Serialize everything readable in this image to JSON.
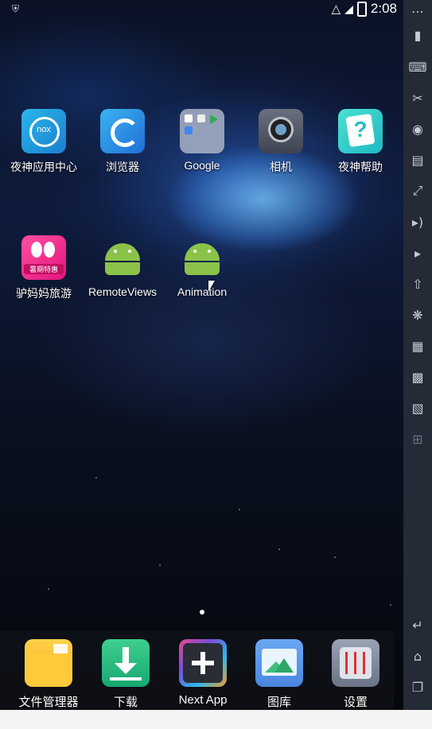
{
  "status_bar": {
    "time": "2:08"
  },
  "home": {
    "apps_row1": [
      {
        "label": "夜神应用中心",
        "icon": "nox-app-center-icon"
      },
      {
        "label": "浏览器",
        "icon": "browser-icon"
      },
      {
        "label": "Google",
        "icon": "google-folder-icon"
      },
      {
        "label": "相机",
        "icon": "camera-icon"
      },
      {
        "label": "夜神帮助",
        "icon": "nox-help-icon"
      }
    ],
    "apps_row2": [
      {
        "label": "驴妈妈旅游",
        "icon": "lvmama-travel-icon"
      },
      {
        "label": "RemoteViews",
        "icon": "android-icon"
      },
      {
        "label": "Animation",
        "icon": "android-icon"
      }
    ],
    "lvmama_badge": "暑期特惠"
  },
  "dock": [
    {
      "label": "文件管理器",
      "icon": "file-manager-icon"
    },
    {
      "label": "下载",
      "icon": "download-icon"
    },
    {
      "label": "Next App",
      "icon": "next-app-icon"
    },
    {
      "label": "图库",
      "icon": "gallery-icon"
    },
    {
      "label": "设置",
      "icon": "settings-icon"
    }
  ],
  "sidebar": {
    "buttons": [
      "more-icon",
      "shake-icon",
      "keyboard-icon",
      "screenshot-icon",
      "location-icon",
      "multi-instance-icon",
      "fullscreen-icon",
      "volume-up-icon",
      "volume-down-icon",
      "install-apk-icon",
      "loading-icon",
      "macro-icon",
      "video-record-icon",
      "toolbox-icon",
      "add-icon"
    ],
    "nav": [
      "back-icon",
      "home-icon",
      "recents-icon"
    ]
  },
  "colors": {
    "sidebar": "#242a36",
    "android_green": "#8bc34a"
  }
}
